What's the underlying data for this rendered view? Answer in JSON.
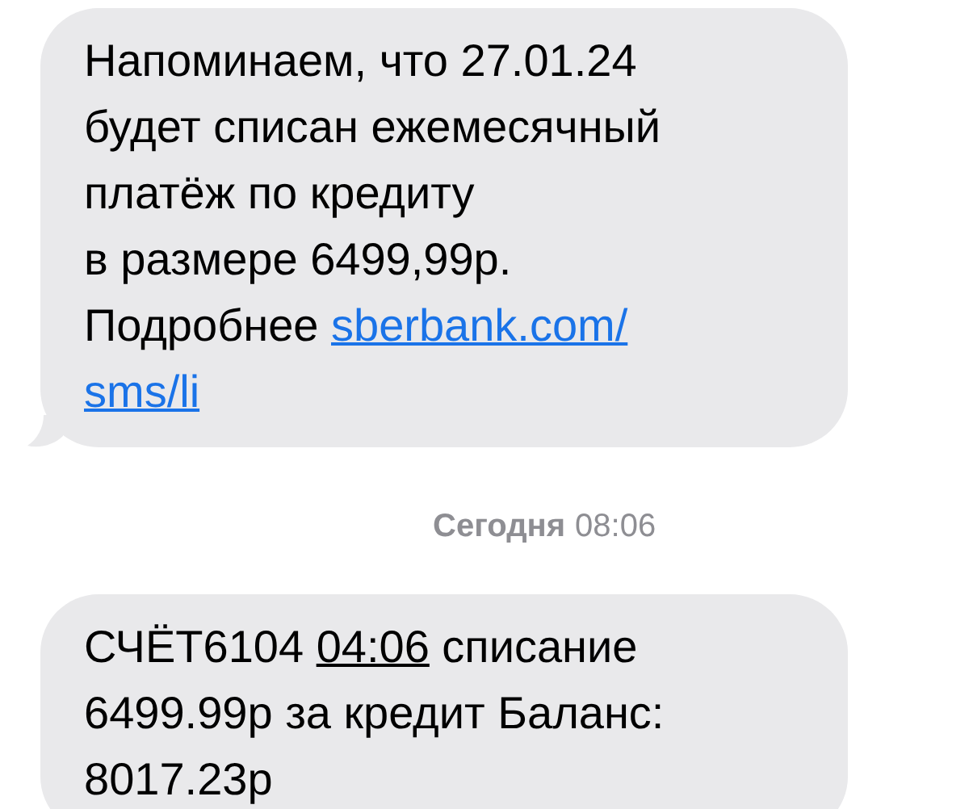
{
  "messages": [
    {
      "kind": "incoming",
      "tail": true,
      "lines": [
        [
          {
            "kind": "text",
            "text": "Напоминаем, что 27.01.24"
          }
        ],
        [
          {
            "kind": "text",
            "text": "будет списан ежемесячный"
          }
        ],
        [
          {
            "kind": "text",
            "text": "платёж по кредиту"
          }
        ],
        [
          {
            "kind": "text",
            "text": "в размере 6499,99р."
          }
        ],
        [
          {
            "kind": "text",
            "text": "Подробнее "
          },
          {
            "kind": "link",
            "text": "sberbank.com/"
          }
        ],
        [
          {
            "kind": "link",
            "text": "sms/li"
          }
        ]
      ]
    },
    {
      "kind": "timestamp",
      "day": "Сегодня",
      "time": "08:06"
    },
    {
      "kind": "incoming",
      "tail": false,
      "lines": [
        [
          {
            "kind": "text",
            "text": "СЧЁТ6104 "
          },
          {
            "kind": "detected",
            "text": "04:06"
          },
          {
            "kind": "text",
            "text": " списание"
          }
        ],
        [
          {
            "kind": "text",
            "text": "6499.99р за кредит Баланс:"
          }
        ],
        [
          {
            "kind": "text",
            "text": "8017.23р"
          }
        ]
      ]
    }
  ]
}
